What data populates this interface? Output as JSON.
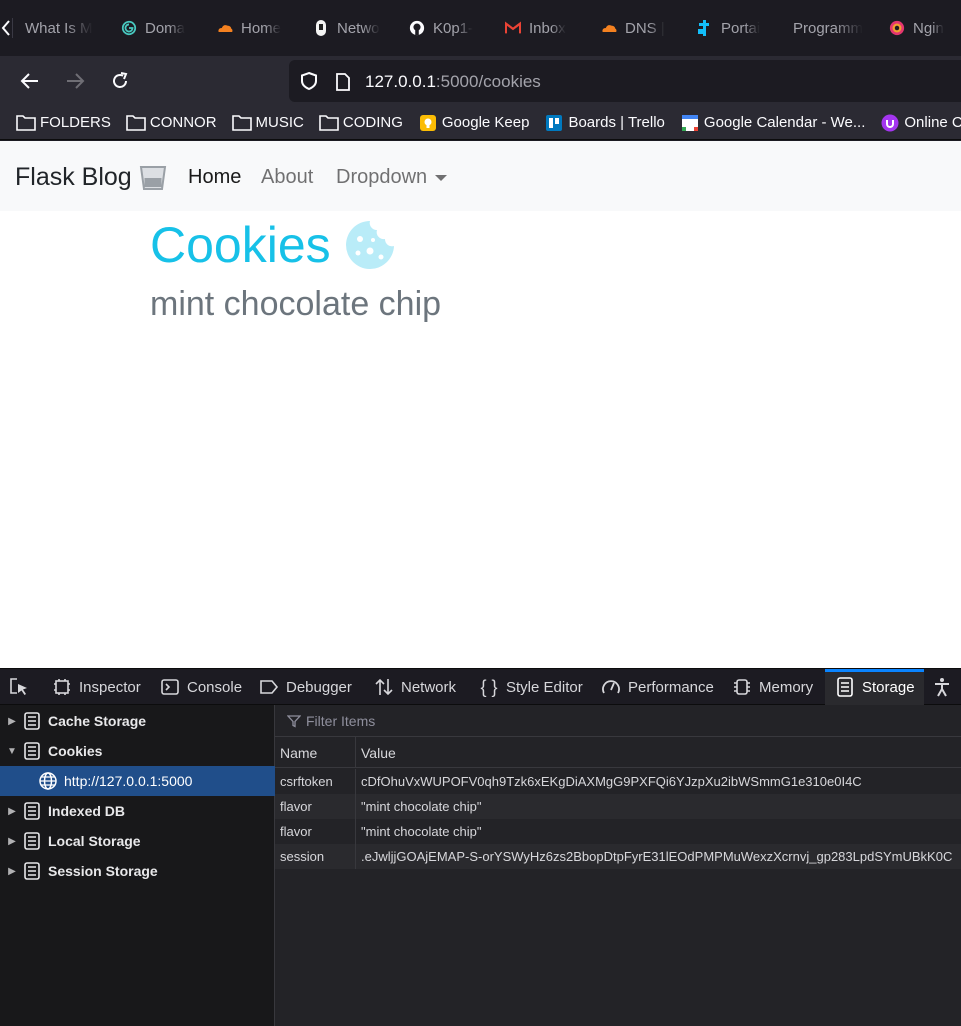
{
  "tabstrip": {
    "tabs": [
      {
        "label": "What Is M",
        "icon": "none"
      },
      {
        "label": "Doma",
        "icon": "domain-icon"
      },
      {
        "label": "Home",
        "icon": "cloudflare-icon"
      },
      {
        "label": "Netwo",
        "icon": "network-icon"
      },
      {
        "label": "K0p1-",
        "icon": "github-icon"
      },
      {
        "label": "Inbox",
        "icon": "gmail-icon"
      },
      {
        "label": "DNS |",
        "icon": "cloudflare-icon"
      },
      {
        "label": "Portai",
        "icon": "portainer-icon"
      },
      {
        "label": "Programm",
        "icon": "none"
      },
      {
        "label": "Ngin",
        "icon": "nginx-icon"
      }
    ]
  },
  "urlbar": {
    "host": "127.0.0.1",
    "path": ":5000/cookies"
  },
  "bookmarks": [
    {
      "label": "FOLDERS",
      "icon": "folder-icon"
    },
    {
      "label": "CONNOR",
      "icon": "folder-icon"
    },
    {
      "label": "MUSIC",
      "icon": "folder-icon"
    },
    {
      "label": "CODING",
      "icon": "folder-icon"
    },
    {
      "label": "Google Keep",
      "icon": "keep-icon"
    },
    {
      "label": "Boards | Trello",
      "icon": "trello-icon"
    },
    {
      "label": "Google Calendar - We...",
      "icon": "calendar-icon"
    },
    {
      "label": "Online Cou",
      "icon": "udemy-icon"
    }
  ],
  "site": {
    "brand": "Flask Blog",
    "nav": {
      "home": "Home",
      "about": "About",
      "dropdown": "Dropdown"
    },
    "heading": "Cookies",
    "flavor": "mint chocolate chip"
  },
  "devtools": {
    "tabs": {
      "inspector": "Inspector",
      "console": "Console",
      "debugger": "Debugger",
      "network": "Network",
      "style_editor": "Style Editor",
      "performance": "Performance",
      "memory": "Memory",
      "storage": "Storage"
    },
    "tree": {
      "cache": "Cache Storage",
      "cookies": "Cookies",
      "host": "http://127.0.0.1:5000",
      "indexed": "Indexed DB",
      "local": "Local Storage",
      "session": "Session Storage"
    },
    "filter_placeholder": "Filter Items",
    "table": {
      "headers": {
        "name": "Name",
        "value": "Value"
      },
      "rows": [
        {
          "name": "csrftoken",
          "value": "cDfOhuVxWUPOFV0qh9Tzk6xEKgDiAXMgG9PXFQi6YJzpXu2ibWSmmG1e310e0I4C"
        },
        {
          "name": "flavor",
          "value": "\"mint chocolate chip\""
        },
        {
          "name": "flavor",
          "value": "\"mint chocolate chip\""
        },
        {
          "name": "session",
          "value": ".eJwljjGOAjEMAP-S-orYSWyHz6zs2BbopDtpFyrE31lEOdPMPMuWexzXcrnvj_gp283LpdSYmUBkK0C"
        }
      ]
    }
  },
  "colors": {
    "accent": "#17c1e8",
    "devtools_selection": "#204e8a",
    "storage_tab_indicator": "#0a84ff"
  }
}
